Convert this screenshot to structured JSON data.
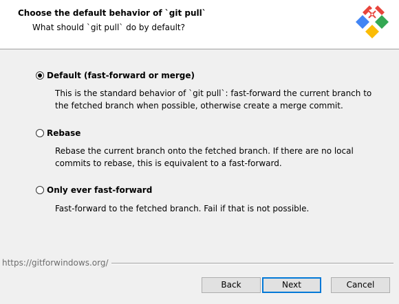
{
  "header": {
    "title": "Choose the default behavior of `git pull`",
    "subtitle": "What should `git pull` do by default?",
    "logo_icon": "git-logo-icon"
  },
  "options": [
    {
      "label": "Default (fast-forward or merge)",
      "selected": true,
      "description_lines": [
        "This is the standard behavior of `git pull`: fast-forward the current branch to",
        "the fetched branch when possible, otherwise create a merge commit."
      ]
    },
    {
      "label": "Rebase",
      "selected": false,
      "description_lines": [
        "Rebase the current branch onto the fetched branch. If there are no local",
        "commits to rebase, this is equivalent to a fast-forward."
      ]
    },
    {
      "label": "Only ever fast-forward",
      "selected": false,
      "description_lines": [
        "Fast-forward to the fetched branch. Fail if that is not possible."
      ]
    }
  ],
  "footer": {
    "url": "https://gitforwindows.org/"
  },
  "buttons": {
    "back": "Back",
    "next": "Next",
    "cancel": "Cancel"
  },
  "colors": {
    "logo_red": "#e8453c",
    "logo_blue": "#4285f4",
    "logo_green": "#34a853",
    "logo_yellow": "#fbbc05",
    "default_button_border": "#0078d7"
  }
}
